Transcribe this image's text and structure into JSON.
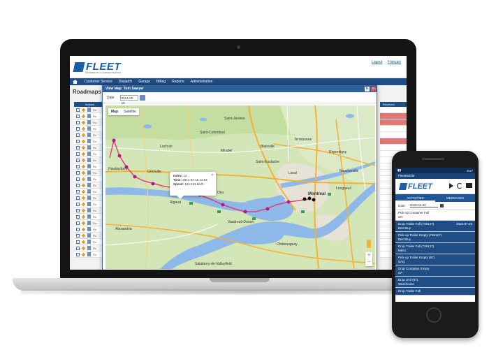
{
  "app": {
    "logo_text": "FLEET",
    "logo_sub": "POWERED BY CLEARDESTINATION",
    "header_links": [
      "Logout",
      "Français"
    ],
    "nav": [
      "Customer Service",
      "Dispatch",
      "Garage",
      "Billing",
      "Reports",
      "Administration"
    ],
    "page_title": "Roadmaps",
    "left_table_header": "Actions",
    "right_table_header": "Received",
    "row_label": "Ro"
  },
  "map_window": {
    "title": "View Map: Tom Sawyer",
    "date_label": "Date",
    "date_value": "2014-02-15",
    "map_types": [
      "Map",
      "Satellite"
    ],
    "info": {
      "index_label": "Index:",
      "index_value": "12",
      "time_label": "Time:",
      "time_value": "2014-02-15 12:04",
      "speed_label": "Speed:",
      "speed_value": "124.213 km/h"
    },
    "zoom_in": "+",
    "zoom_out": "−"
  },
  "map_labels": {
    "cities": [
      {
        "name": "Saint-Jérôme"
      },
      {
        "name": "Terrebonne"
      },
      {
        "name": "Laval"
      },
      {
        "name": "Montreal"
      },
      {
        "name": "Longueuil"
      },
      {
        "name": "Lachute"
      },
      {
        "name": "Mirabel"
      },
      {
        "name": "Saint-Eustache"
      },
      {
        "name": "Hawkesbury"
      },
      {
        "name": "Rigaud"
      },
      {
        "name": "Vaudreuil-Dorion"
      },
      {
        "name": "Châteauguay"
      },
      {
        "name": "Boucherville"
      },
      {
        "name": "Salaberry-de-Valleyfield"
      },
      {
        "name": "Oka"
      },
      {
        "name": "Grenville"
      },
      {
        "name": "Alexandria"
      },
      {
        "name": "Saint-Colomban"
      },
      {
        "name": "Blainville"
      },
      {
        "name": "Repentigny"
      }
    ]
  },
  "phone": {
    "app_title": "FleetMobile",
    "status_time": "9:27",
    "logo_text": "FLEET",
    "tabs": [
      "ACTIVITIES",
      "MESSAGES"
    ],
    "date_label": "Date:",
    "date_value": "2016-01-26",
    "items": [
      {
        "title": "Pick-up Container Full",
        "sub": "CN",
        "date": "",
        "style": "white"
      },
      {
        "title": "Drop Trailer Full (736127)",
        "sub": "Best Buy",
        "date": "2016-07-23",
        "style": "blue"
      },
      {
        "title": "Pick-up Trailer Empty (736127)",
        "sub": "Best Buy",
        "date": "",
        "style": "blue"
      },
      {
        "title": "Drop Trailer Full (736127)",
        "sub": "Metro",
        "date": "",
        "style": "blue"
      },
      {
        "title": "Pick-up Trailer Empty (87)",
        "sub": "SAQ",
        "date": "",
        "style": "blue"
      },
      {
        "title": "Drop Container Empty",
        "sub": "CP",
        "date": "",
        "style": "blue"
      },
      {
        "title": "Drop Unit (87)",
        "sub": "Warehouse",
        "date": "",
        "style": "blue"
      },
      {
        "title": "Drop Trailer Full",
        "sub": "",
        "date": "",
        "style": "blue"
      }
    ]
  },
  "colors": {
    "brand": "#1a5fa8",
    "nav": "#1f4d85",
    "route": "#e0407a",
    "water": "#8db8e8",
    "map_land": "#cfe5b0",
    "highway": "#f2b233"
  }
}
